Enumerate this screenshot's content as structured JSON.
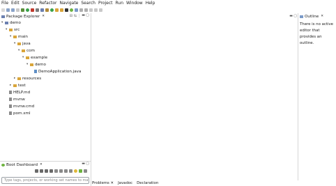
{
  "menu": [
    "File",
    "Edit",
    "Source",
    "Refactor",
    "Navigate",
    "Search",
    "Project",
    "Run",
    "Window",
    "Help"
  ],
  "package_explorer": {
    "title": "Package Explorer",
    "close": "✕",
    "tree": [
      {
        "label": "demo",
        "depth": 0,
        "expanded": true,
        "icon": "project-icon"
      },
      {
        "label": "src",
        "depth": 1,
        "expanded": true,
        "icon": "folder-icon"
      },
      {
        "label": "main",
        "depth": 2,
        "expanded": true,
        "icon": "folder-icon"
      },
      {
        "label": "java",
        "depth": 3,
        "expanded": true,
        "icon": "folder-icon"
      },
      {
        "label": "com",
        "depth": 4,
        "expanded": true,
        "icon": "folder-icon"
      },
      {
        "label": "example",
        "depth": 5,
        "expanded": true,
        "icon": "folder-icon"
      },
      {
        "label": "demo",
        "depth": 6,
        "expanded": true,
        "icon": "folder-icon"
      },
      {
        "label": "DemoApplication.java",
        "depth": 7,
        "expanded": null,
        "icon": "java-file-icon"
      },
      {
        "label": "resources",
        "depth": 3,
        "expanded": false,
        "icon": "folder-icon"
      },
      {
        "label": "test",
        "depth": 2,
        "expanded": false,
        "icon": "folder-icon"
      },
      {
        "label": "HELP.md",
        "depth": 1,
        "expanded": null,
        "icon": "md-file-icon"
      },
      {
        "label": "mvnw",
        "depth": 1,
        "expanded": null,
        "icon": "file-icon"
      },
      {
        "label": "mvnw.cmd",
        "depth": 1,
        "expanded": null,
        "icon": "file-icon"
      },
      {
        "label": "pom.xml",
        "depth": 1,
        "expanded": null,
        "icon": "xml-file-icon"
      }
    ]
  },
  "outline": {
    "title": "Outline",
    "close": "✕",
    "message": "There is no active editor that provides an outline."
  },
  "boot_dashboard": {
    "title": "Boot Dashboard",
    "close": "✕",
    "search_placeholder": "Type tags, projects, or working set names to match (incl. * and ? wildcards)"
  },
  "bottom_tabs": [
    "Problems ✕",
    "Javadoc",
    "Declaration"
  ],
  "colors": {
    "folder": "#d9a53a",
    "project": "#6a7fb0",
    "java_file": "#5f8fc6",
    "file": "#8a8a8a",
    "accent": "#2f6fc7"
  }
}
